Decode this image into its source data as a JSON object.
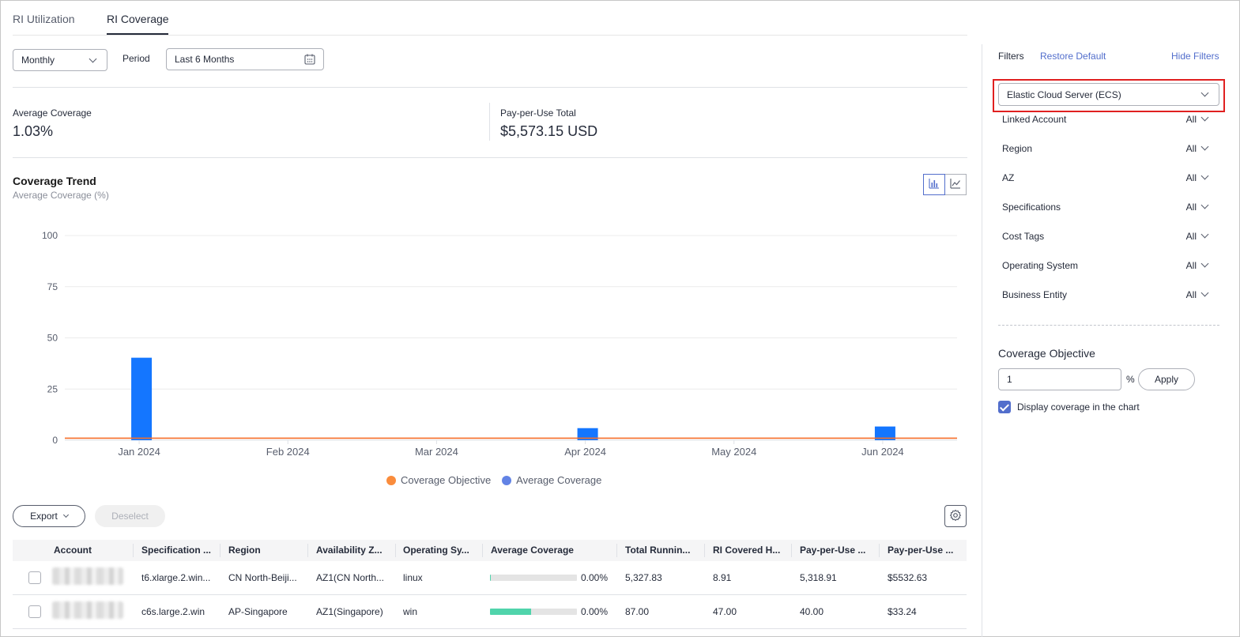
{
  "tabs": [
    {
      "label": "RI Utilization",
      "active": false
    },
    {
      "label": "RI Coverage",
      "active": true
    }
  ],
  "controls": {
    "granularity": "Monthly",
    "period_label": "Period",
    "period_value": "Last 6 Months"
  },
  "summary": {
    "avg_coverage_label": "Average Coverage",
    "avg_coverage_value": "1.03%",
    "ppu_total_label": "Pay-per-Use Total",
    "ppu_total_value": "$5,573.15 USD"
  },
  "trend": {
    "title": "Coverage Trend",
    "subtitle": "Average Coverage (%)"
  },
  "chart_data": {
    "type": "bar",
    "categories": [
      "Jan 2024",
      "Feb 2024",
      "Mar 2024",
      "Apr 2024",
      "May 2024",
      "Jun 2024"
    ],
    "series": [
      {
        "name": "Coverage Objective",
        "type": "line",
        "color": "#f66f2a",
        "values": [
          1,
          1,
          1,
          1,
          1,
          1
        ]
      },
      {
        "name": "Average Coverage",
        "type": "bar",
        "color": "#1476ff",
        "values": [
          40.3,
          0,
          0,
          5.9,
          0,
          6.7
        ]
      }
    ],
    "yticks": [
      0,
      25,
      50,
      75,
      100
    ],
    "ylim": [
      0,
      100
    ],
    "legend": [
      {
        "name": "Coverage Objective",
        "color": "#fa8c3c"
      },
      {
        "name": "Average Coverage",
        "color": "#6283e5"
      }
    ],
    "legend_position": "bottom",
    "grid": true
  },
  "toolbar": {
    "export_label": "Export",
    "deselect_label": "Deselect"
  },
  "table": {
    "columns": [
      "Account",
      "Specification ...",
      "Region",
      "Availability Z...",
      "Operating Sy...",
      "Average Coverage",
      "Total Runnin...",
      "RI Covered H...",
      "Pay-per-Use ...",
      "Pay-per-Use ..."
    ],
    "rows": [
      {
        "spec": "t6.xlarge.2.win...",
        "region": "CN North-Beiji...",
        "az": "AZ1(CN North...",
        "os": "linux",
        "coverage": "0.00%",
        "coverage_fill": 0.01,
        "total_running": "5,327.83",
        "ri_covered": "8.91",
        "ppu_hours": "5,318.91",
        "ppu_cost": "$5532.63"
      },
      {
        "spec": "c6s.large.2.win",
        "region": "AP-Singapore",
        "az": "AZ1(Singapore)",
        "os": "win",
        "coverage": "0.00%",
        "coverage_fill": 0.47,
        "total_running": "87.00",
        "ri_covered": "47.00",
        "ppu_hours": "40.00",
        "ppu_cost": "$33.24"
      }
    ]
  },
  "filters": {
    "title": "Filters",
    "restore_label": "Restore Default",
    "hide_label": "Hide Filters",
    "service": "Elastic Cloud Server (ECS)",
    "items": [
      {
        "name": "Linked Account",
        "value": "All"
      },
      {
        "name": "Region",
        "value": "All"
      },
      {
        "name": "AZ",
        "value": "All"
      },
      {
        "name": "Specifications",
        "value": "All"
      },
      {
        "name": "Cost Tags",
        "value": "All"
      },
      {
        "name": "Operating System",
        "value": "All"
      },
      {
        "name": "Business Entity",
        "value": "All"
      }
    ],
    "objective_title": "Coverage Objective",
    "objective_value": "1",
    "objective_unit": "%",
    "apply_label": "Apply",
    "display_label": "Display coverage in the chart",
    "display_checked": true
  }
}
